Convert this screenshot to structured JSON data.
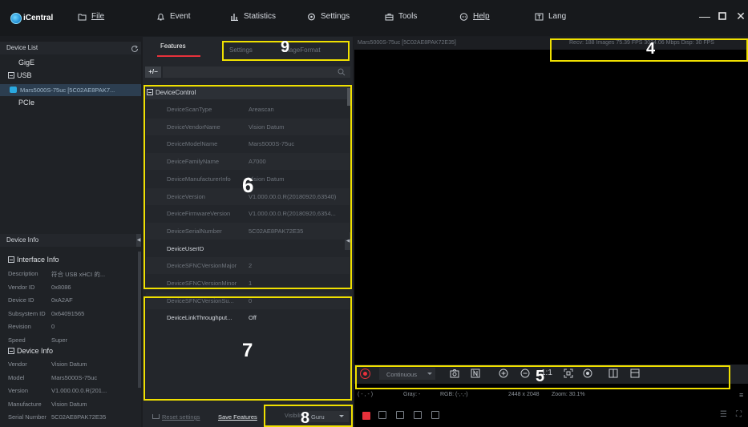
{
  "app": {
    "name": "iCentral"
  },
  "menu": [
    {
      "label": "File",
      "icon": "folder-icon"
    },
    {
      "label": "Event",
      "icon": "bell-icon"
    },
    {
      "label": "Statistics",
      "icon": "bar-chart-icon"
    },
    {
      "label": "Settings",
      "icon": "gear-icon"
    },
    {
      "label": "Tools",
      "icon": "toolbox-icon"
    },
    {
      "label": "Help",
      "icon": "help-icon"
    },
    {
      "label": "Lang",
      "icon": "lang-icon"
    }
  ],
  "device_list": {
    "title": "Device List",
    "groups": [
      "GigE",
      "USB",
      "PCIe"
    ],
    "device": "Mars5000S-75uc [5C02AE8PAK7..."
  },
  "device_info": {
    "title": "Device Info",
    "interface_header": "Interface Info",
    "interface_rows": [
      {
        "label": "Description",
        "value": "符合 USB xHCI 的..."
      },
      {
        "label": "Vendor ID",
        "value": "0x8086"
      },
      {
        "label": "Device ID",
        "value": "0xA2AF"
      },
      {
        "label": "Subsystem ID",
        "value": "0x64091565"
      },
      {
        "label": "Revision",
        "value": "0"
      },
      {
        "label": "Speed",
        "value": "Super"
      }
    ],
    "device_header": "Device Info",
    "device_rows": [
      {
        "label": "Vendor",
        "value": "Vision Datum"
      },
      {
        "label": "Model",
        "value": "Mars5000S-75uc"
      },
      {
        "label": "Version",
        "value": "V1.000.00.0.R(201..."
      },
      {
        "label": "Manufacture",
        "value": "Vision Datum"
      },
      {
        "label": "Serial Number",
        "value": "5C02AE8PAK72E35"
      }
    ]
  },
  "features": {
    "tabs": [
      "Features",
      "Settings",
      "ImageFormat"
    ],
    "expand_label": "+/−",
    "category": "DeviceControl",
    "rows": [
      {
        "name": "DeviceScanType",
        "value": "Areascan"
      },
      {
        "name": "DeviceVendorName",
        "value": "Vision Datum"
      },
      {
        "name": "DeviceModelName",
        "value": "Mars5000S-75uc"
      },
      {
        "name": "DeviceFamilyName",
        "value": "A7000"
      },
      {
        "name": "DeviceManufacturerInfo",
        "value": "Vision Datum"
      },
      {
        "name": "DeviceVersion",
        "value": "V1.000.00.0.R(20180920,63540)"
      },
      {
        "name": "DeviceFirmwareVersion",
        "value": "V1.000.00.0.R(20180920,6354..."
      },
      {
        "name": "DeviceSerialNumber",
        "value": "5C02AE8PAK72E35"
      },
      {
        "name": "DeviceUserID",
        "value": ""
      },
      {
        "name": "DeviceSFNCVersionMajor",
        "value": "2"
      },
      {
        "name": "DeviceSFNCVersionMinor",
        "value": "1"
      },
      {
        "name": "DeviceSFNCVersionSu...",
        "value": "0"
      },
      {
        "name": "DeviceLinkThroughput...",
        "value": "Off"
      }
    ],
    "reset_label": "Reset settings",
    "save_label": "Save Features",
    "visibility_label": "Visibility",
    "visibility_value": "Guru"
  },
  "viewer": {
    "title": "Mars5000S-75uc [5C02AE8PAK72E35]",
    "stats": "Recv: 188 Images  75.39 FPS  3024.06 Mbps  Disp: 30 FPS",
    "mode": "Continuous",
    "ratio": "1:1",
    "coords": "( - , - )",
    "gray": "Gray: -",
    "rgb": "RGB: (-,-,-)",
    "resolution": "2448 x 2048",
    "zoom": "Zoom: 30.1%"
  },
  "annotations": [
    "4",
    "5",
    "6",
    "7",
    "8",
    "9"
  ],
  "colors": {
    "highlight": "#f0e000",
    "record": "#e8313b",
    "background": "#1b1d21"
  }
}
